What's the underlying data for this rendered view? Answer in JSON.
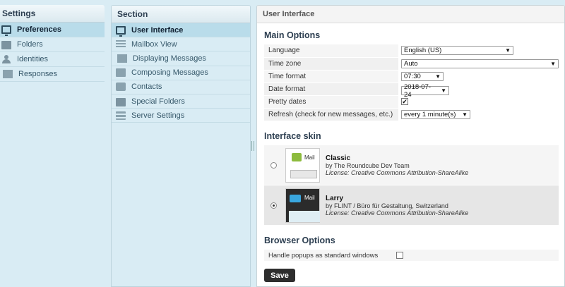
{
  "settings": {
    "title": "Settings",
    "items": [
      {
        "label": "Preferences",
        "icon": "monitor-icon"
      },
      {
        "label": "Folders",
        "icon": "folder-icon"
      },
      {
        "label": "Identities",
        "icon": "person-icon"
      },
      {
        "label": "Responses",
        "icon": "document-icon"
      }
    ]
  },
  "section": {
    "title": "Section",
    "items": [
      {
        "label": "User Interface",
        "icon": "monitor-icon"
      },
      {
        "label": "Mailbox View",
        "icon": "list-icon"
      },
      {
        "label": "Displaying Messages",
        "icon": "document-icon"
      },
      {
        "label": "Composing Messages",
        "icon": "edit-icon"
      },
      {
        "label": "Contacts",
        "icon": "contact-icon"
      },
      {
        "label": "Special Folders",
        "icon": "folder-icon"
      },
      {
        "label": "Server Settings",
        "icon": "server-icon"
      }
    ]
  },
  "content": {
    "title": "User Interface",
    "main_options": {
      "title": "Main Options",
      "rows": [
        {
          "label": "Language",
          "value": "English (US)"
        },
        {
          "label": "Time zone",
          "value": "Auto"
        },
        {
          "label": "Time format",
          "value": "07:30"
        },
        {
          "label": "Date format",
          "value": "2018-07-24"
        },
        {
          "label": "Pretty dates",
          "checked": "✔"
        },
        {
          "label": "Refresh (check for new messages, etc.)",
          "value": "every 1 minute(s)"
        }
      ]
    },
    "interface_skin": {
      "title": "Interface skin",
      "skins": [
        {
          "thumb_label": "Mail",
          "name": "Classic",
          "author": "by The Roundcube Dev Team",
          "license": "License: Creative Commons Attribution-ShareAlike"
        },
        {
          "thumb_label": "Mail",
          "name": "Larry",
          "author": "by FLINT / Büro für Gestaltung, Switzerland",
          "license": "License: Creative Commons Attribution-ShareAlike"
        }
      ]
    },
    "browser_options": {
      "title": "Browser Options",
      "popup_label": "Handle popups as standard windows"
    },
    "save_label": "Save"
  }
}
